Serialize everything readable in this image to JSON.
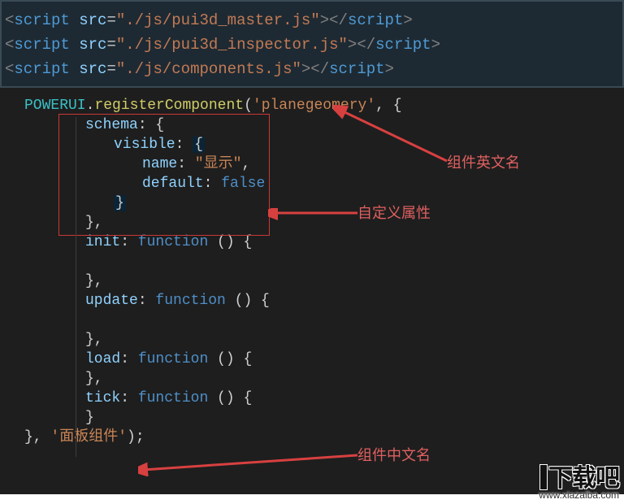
{
  "top": {
    "lines": [
      {
        "src": "./js/pui3d_master.js"
      },
      {
        "src": "./js/pui3d_inspector.js"
      },
      {
        "src": "./js/components.js"
      }
    ],
    "tagOpen": "script",
    "attr": "src",
    "tagClose": "script"
  },
  "code": {
    "powerui": "POWERUI",
    "register": "registerComponent",
    "compName": "'planegeomery'",
    "schemaKey": "schema",
    "visibleKey": "visible",
    "nameKey": "name",
    "nameVal": "\"显示\"",
    "defaultKey": "default",
    "falseKw": "false",
    "initKey": "init",
    "updateKey": "update",
    "loadKey": "load",
    "tickKey": "tick",
    "functionKw": "function",
    "chineseName": "'面板组件'"
  },
  "annotations": {
    "enName": "组件英文名",
    "customAttr": "自定义属性",
    "cnName": "组件中文名"
  },
  "watermark": {
    "logo": "下载吧",
    "url": "www.xiazaiba.com"
  }
}
